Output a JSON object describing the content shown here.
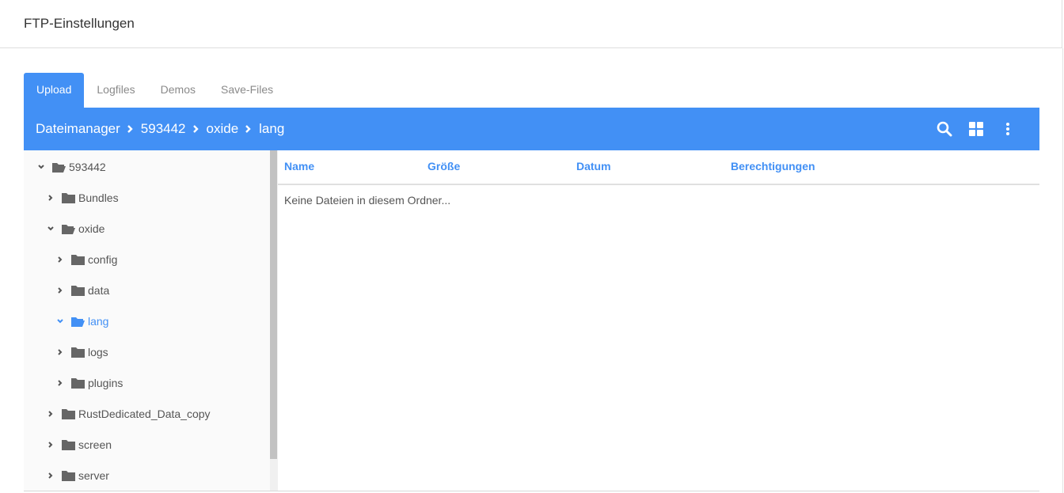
{
  "page": {
    "title": "FTP-Einstellungen"
  },
  "tabs": [
    "Upload",
    "Logfiles",
    "Demos",
    "Save-Files"
  ],
  "breadcrumb": [
    "Dateimanager",
    "593442",
    "oxide",
    "lang"
  ],
  "toolbar_icons": [
    "search-icon",
    "grid-view-icon",
    "more-vert-icon"
  ],
  "tree": {
    "items": [
      {
        "label": "593442",
        "expanded": true
      },
      {
        "label": "Bundles",
        "expanded": false
      },
      {
        "label": "oxide",
        "expanded": true
      },
      {
        "label": "config",
        "expanded": false
      },
      {
        "label": "data",
        "expanded": false
      },
      {
        "label": "lang",
        "expanded": true,
        "selected": true
      },
      {
        "label": "logs",
        "expanded": false
      },
      {
        "label": "plugins",
        "expanded": false
      },
      {
        "label": "RustDedicated_Data_copy",
        "expanded": false
      },
      {
        "label": "screen",
        "expanded": false
      },
      {
        "label": "server",
        "expanded": false
      }
    ]
  },
  "table": {
    "columns": [
      "Name",
      "Größe",
      "Datum",
      "Berechtigungen"
    ],
    "empty_message": "Keine Dateien in diesem Ordner..."
  },
  "colors": {
    "accent": "#4290f5",
    "folder": "#666666"
  }
}
